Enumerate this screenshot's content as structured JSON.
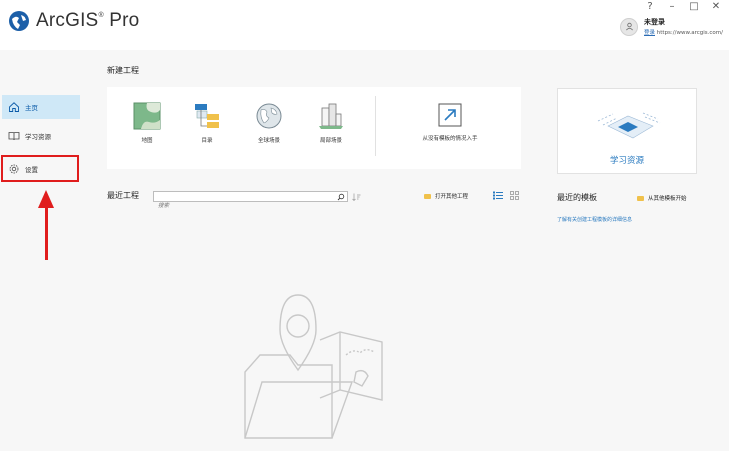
{
  "app": {
    "logo_text": "ArcGIS",
    "logo_mark": "®",
    "logo_suffix": " Pro"
  },
  "window": {
    "help": "?",
    "minimize": "–",
    "maximize": "□",
    "close": "✕"
  },
  "user": {
    "name": "未登录",
    "signin": "登录",
    "url": "https://www.arcgis.com/"
  },
  "sidebar": {
    "items": [
      {
        "label": "主页",
        "icon": "home-icon",
        "active": true
      },
      {
        "label": "学习资源",
        "icon": "book-icon",
        "active": false
      },
      {
        "label": "设置",
        "icon": "gear-icon",
        "active": false
      }
    ]
  },
  "new_project": {
    "title": "新建工程",
    "templates": [
      {
        "label": "地图",
        "icon": "map-icon"
      },
      {
        "label": "目录",
        "icon": "catalog-icon"
      },
      {
        "label": "全球场景",
        "icon": "globe-icon"
      },
      {
        "label": "局部场景",
        "icon": "local-scene-icon"
      }
    ],
    "start_without_template": "从没有模板的情况入手"
  },
  "learning": {
    "label": "学习资源"
  },
  "recent_projects": {
    "title": "最近工程",
    "search_placeholder": "搜索",
    "open_other": "打开其他工程"
  },
  "recent_templates": {
    "title": "最近的模板",
    "start_from_other": "从其他模板开始",
    "learn_more_link": "了解有关创建工程模板的详细信息"
  },
  "colors": {
    "accent": "#2b7bc0",
    "highlight": "#e01d1d",
    "active_bg": "#cfe8f7"
  }
}
